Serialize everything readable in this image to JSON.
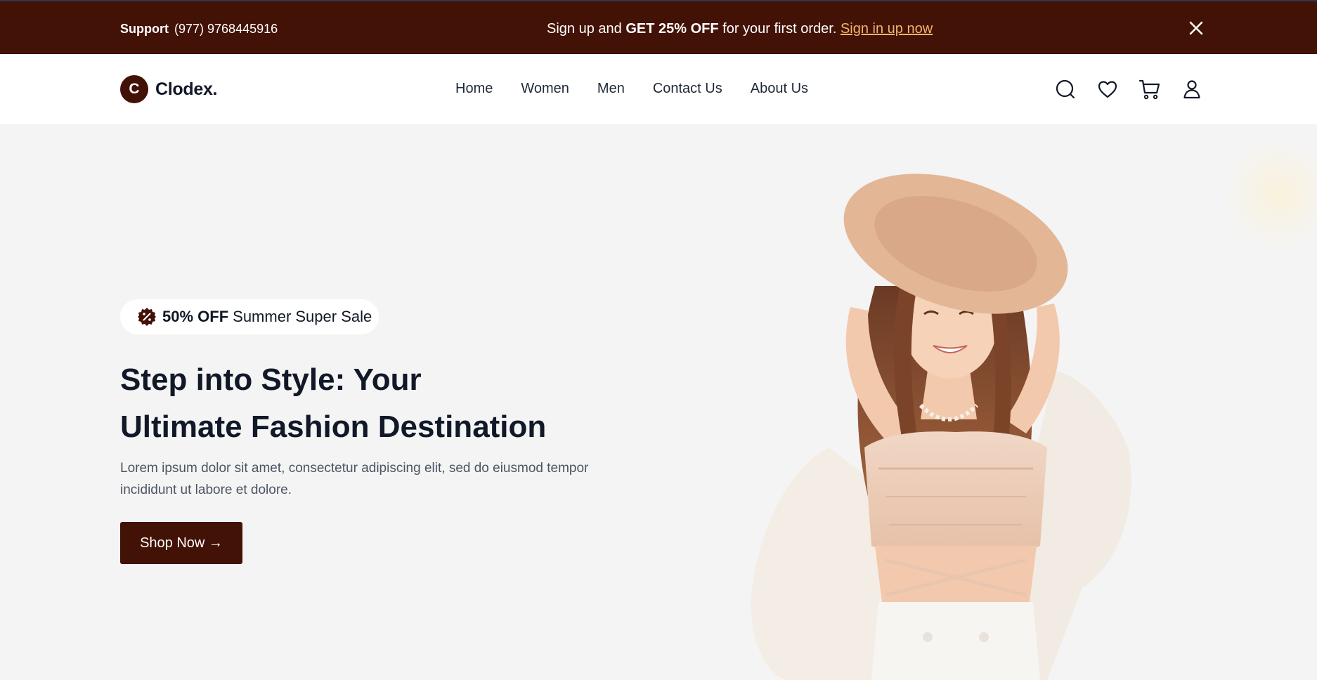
{
  "colors": {
    "brand": "#431206",
    "accent_link": "#f0b46c",
    "hero_bg": "#f4f4f4",
    "heading": "#111827",
    "body_text": "#4b5563"
  },
  "announcement": {
    "support_label": "Support",
    "support_phone": "(977)  9768445916",
    "promo_prefix": "Sign up and ",
    "promo_bold": "GET 25% OFF",
    "promo_suffix": " for your first order. ",
    "promo_link": "Sign in up now",
    "close_icon": "close-icon"
  },
  "navbar": {
    "logo_letter": "C",
    "brand_name": "Clodex.",
    "links": [
      "Home",
      "Women",
      "Men",
      "Contact Us",
      "About Us"
    ],
    "icons": [
      "search-icon",
      "heart-icon",
      "cart-icon",
      "user-icon"
    ]
  },
  "hero": {
    "badge_icon": "discount-icon",
    "badge_bold": "50% OFF",
    "badge_text": "Summer Super Sale",
    "headline_line1": "Step into Style: Your",
    "headline_line2": "Ultimate Fashion Destination",
    "description": "Lorem ipsum dolor sit amet, consectetur adipiscing elit, sed do eiusmod tempor incididunt ut labore et dolore.",
    "cta_label": "Shop Now →"
  }
}
